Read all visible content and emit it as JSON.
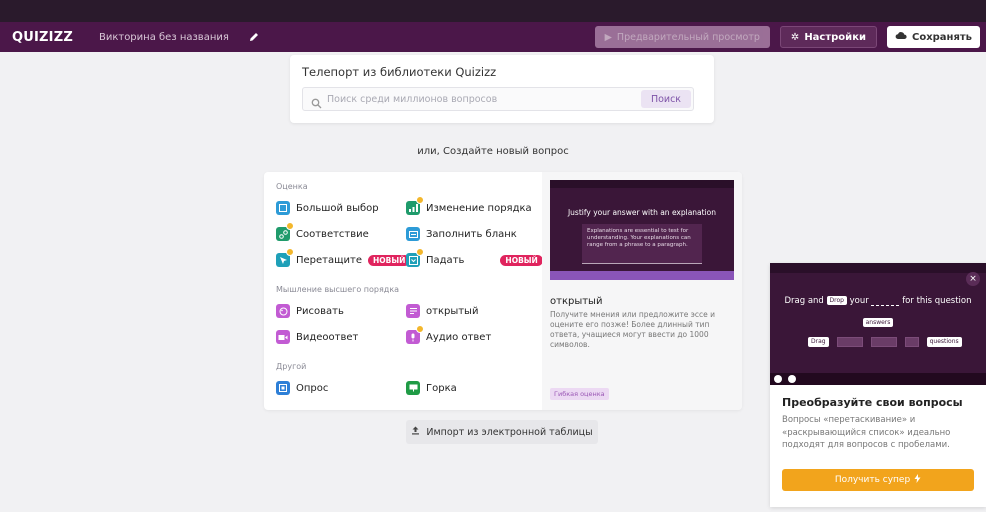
{
  "header": {
    "logo": "QUIZIZZ",
    "quiz_title": "Викторина без названия",
    "preview_label": "Предварительный просмотр",
    "settings_label": "Настройки",
    "save_label": "Сохранять"
  },
  "library": {
    "title": "Телепорт из библиотеки Quizizz",
    "search_placeholder": "Поиск среди миллионов вопросов",
    "search_button": "Поиск"
  },
  "or_create": "или, Создайте новый вопрос",
  "question_types": {
    "assessment_label": "Оценка",
    "higher_order_label": "Мышление высшего порядка",
    "other_label": "Другой",
    "new_badge": "НОВЫЙ",
    "items": {
      "multiple_choice": "Большой выбор",
      "reorder": "Изменение порядка",
      "match": "Соответствие",
      "fill_blank": "Заполнить бланк",
      "drag_drop": "Перетащите",
      "dropdown": "Падать",
      "draw": "Рисовать",
      "open_ended": "открытый",
      "video_response": "Видеоответ",
      "audio_response": "Аудио ответ",
      "poll": "Опрос",
      "slide": "Горка"
    }
  },
  "preview": {
    "heading": "Justify your answer with an explanation",
    "box_text": "Explanations are essential to test for understanding. Your explanations can range from a phrase to a paragraph.",
    "title": "открытый",
    "description": "Получите мнения или предложите эссе и оцените его позже! Более длинный тип ответа, учащиеся могут ввести до 1000 символов.",
    "tag": "Гибкая оценка"
  },
  "import_button": "Импорт из электронной таблицы",
  "promo": {
    "line_part1": "Drag and",
    "chip_drop": "Drop",
    "line_part2": "your",
    "line_part3": "for this question",
    "chip_answers": "answers",
    "chip_drag": "Drag",
    "chip_questions": "questions",
    "close": "×",
    "heading": "Преобразуйте свои вопросы",
    "description": "Вопросы «перетаскивание» и «раскрывающийся список» идеально подходят для вопросов с пробелами.",
    "button": "Получить супер"
  },
  "colors": {
    "header_bg": "#4b1749",
    "accent_purple": "#8a55b8",
    "new_badge": "#e0245e",
    "promo_button": "#f2a41c"
  }
}
